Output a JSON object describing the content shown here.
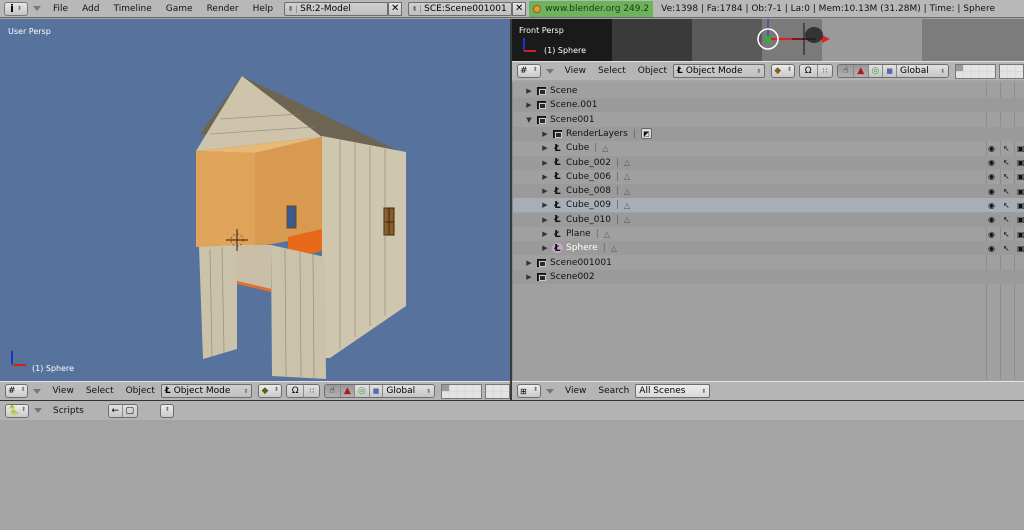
{
  "topbar": {
    "info_icon": "info-icon",
    "menus": [
      "File",
      "Add",
      "Timeline",
      "Game",
      "Render",
      "Help"
    ],
    "screen_field": "SR:2-Model",
    "scene_field": "SCE:Scene001001",
    "website": "www.blender.org 249.2",
    "stats": "Ve:1398 | Fa:1784 | Ob:7-1 | La:0  | Mem:10.13M (31.28M)  | Time: | Sphere"
  },
  "viewport_left": {
    "view_label": "User Persp",
    "object_label": "(1) Sphere",
    "header": {
      "menus": [
        "View",
        "Select",
        "Object"
      ],
      "mode": "Object Mode",
      "orientation": "Global"
    }
  },
  "viewport_right": {
    "view_label": "Front Persp",
    "object_label": "(1) Sphere",
    "header": {
      "menus": [
        "View",
        "Select",
        "Object"
      ],
      "mode": "Object Mode",
      "orientation": "Global"
    }
  },
  "outliner": {
    "rows": [
      {
        "label": "Scene",
        "type": "scene",
        "indent": 0,
        "expanded": false
      },
      {
        "label": "Scene.001",
        "type": "scene",
        "indent": 0,
        "expanded": false
      },
      {
        "label": "Scene001",
        "type": "scene",
        "indent": 0,
        "expanded": true
      },
      {
        "label": "RenderLayers",
        "type": "renderlayers",
        "indent": 1
      },
      {
        "label": "Cube",
        "type": "object",
        "indent": 1
      },
      {
        "label": "Cube_002",
        "type": "object",
        "indent": 1
      },
      {
        "label": "Cube_006",
        "type": "object",
        "indent": 1
      },
      {
        "label": "Cube_008",
        "type": "object",
        "indent": 1
      },
      {
        "label": "Cube_009",
        "type": "object",
        "indent": 1,
        "selected": true
      },
      {
        "label": "Cube_010",
        "type": "object",
        "indent": 1
      },
      {
        "label": "Plane",
        "type": "object",
        "indent": 1
      },
      {
        "label": "Sphere",
        "type": "object",
        "indent": 1,
        "active": true
      },
      {
        "label": "Scene001001",
        "type": "scene",
        "indent": 0,
        "expanded": false
      },
      {
        "label": "Scene002",
        "type": "scene",
        "indent": 0,
        "expanded": false
      }
    ],
    "header": {
      "menus": [
        "View",
        "Search"
      ],
      "display": "All Scenes"
    }
  },
  "scripts_header": {
    "label": "Scripts"
  },
  "colors": {
    "viewport_bg": "#57729c",
    "web_badge": "#6cb35c",
    "selected_row": "#a8aeb6",
    "active_text": "#ffffff"
  }
}
